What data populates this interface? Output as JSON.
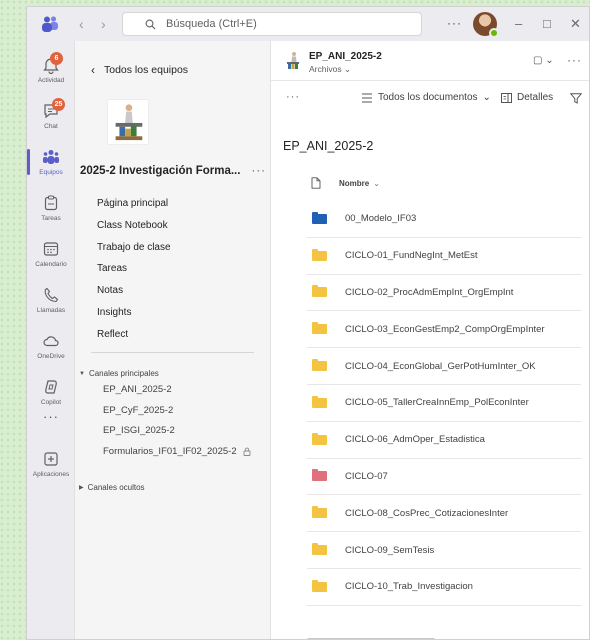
{
  "titlebar": {
    "search_placeholder": "Búsqueda (Ctrl+E)",
    "back_arrow": "‹",
    "forward_arrow": "›",
    "more": "···",
    "minimize": "–",
    "maximize": "□",
    "close": "✕"
  },
  "appbar": {
    "items": [
      {
        "label": "Actividad",
        "icon": "bell-icon",
        "badge": "6"
      },
      {
        "label": "Chat",
        "icon": "chat-icon",
        "badge": "25"
      },
      {
        "label": "Equipos",
        "icon": "teams-icon",
        "active": true
      },
      {
        "label": "Tareas",
        "icon": "tasks-icon"
      },
      {
        "label": "Calendario",
        "icon": "calendar-icon"
      },
      {
        "label": "Llamadas",
        "icon": "phone-icon"
      },
      {
        "label": "OneDrive",
        "icon": "cloud-icon"
      },
      {
        "label": "Copilot",
        "icon": "copilot-icon"
      }
    ],
    "more": "···",
    "apps_label": "Aplicaciones"
  },
  "team_panel": {
    "back_label": "Todos los equipos",
    "team_name": "2025-2 Investigación Forma...",
    "team_more": "···",
    "nav": [
      "Página principal",
      "Class Notebook",
      "Trabajo de clase",
      "Tareas",
      "Notas",
      "Insights",
      "Reflect"
    ],
    "main_channels_label": "Canales principales",
    "channels": [
      "EP_ANI_2025-2",
      "EP_CyF_2025-2",
      "EP_ISGI_2025-2",
      "Formularios_IF01_IF02_2025-2"
    ],
    "hidden_channels_label": "Canales ocultos"
  },
  "main": {
    "channel_title": "EP_ANI_2025-2",
    "channel_sub": "Archivos ⌄",
    "meet_label": "▢ ⌄",
    "header_more": "···",
    "toolbar_more": "···",
    "view_label": "Todos los documentos",
    "details_label": "Detalles",
    "folder_title": "EP_ANI_2025-2",
    "column_name": "Nombre",
    "rows": [
      {
        "name": "00_Modelo_IF03",
        "color": "#1f5fb4"
      },
      {
        "name": "CICLO-01_FundNegInt_MetEst",
        "color": "#f5c342"
      },
      {
        "name": "CICLO-02_ProcAdmEmpInt_OrgEmpInt",
        "color": "#f5c342"
      },
      {
        "name": "CICLO-03_EconGestEmp2_CompOrgEmpInter",
        "color": "#f5c342"
      },
      {
        "name": "CICLO-04_EconGlobal_GerPotHumInter_OK",
        "color": "#f5c342"
      },
      {
        "name": "CICLO-05_TallerCreaInnEmp_PolEconInter",
        "color": "#f5c342"
      },
      {
        "name": "CICLO-06_AdmOper_Estadistica",
        "color": "#f5c342"
      },
      {
        "name": "CICLO-07",
        "color": "#e0707c"
      },
      {
        "name": "CICLO-08_CosPrec_CotizacionesInter",
        "color": "#f5c342"
      },
      {
        "name": "CICLO-09_SemTesis",
        "color": "#f5c342"
      },
      {
        "name": "CICLO-10_Trab_Investigacion",
        "color": "#f5c342"
      }
    ]
  }
}
